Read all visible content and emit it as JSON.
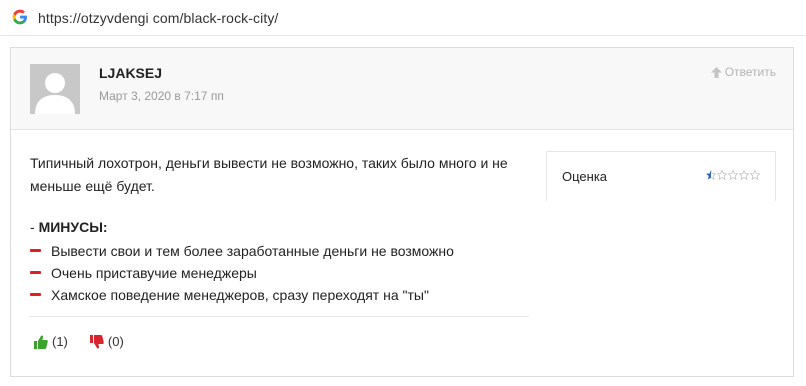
{
  "browser": {
    "url": "https://otzyvdengi com/black-rock-city/"
  },
  "review": {
    "author": "LJAKSEJ",
    "date": "Март 3, 2020 в 7:17 пп",
    "reply_label": "Ответить",
    "text": "Типичный лохотрон, деньги вывести не возможно, таких было много и не меньше ещё будет.",
    "cons_prefix": "- ",
    "cons_title": "МИНУСЫ:",
    "cons": [
      "Вывести свои и тем более заработанные деньги не возможно",
      "Очень приставучие менеджеры",
      "Хамское поведение менеджеров, сразу переходят на \"ты\""
    ],
    "likes": "(1)",
    "dislikes": "(0)",
    "rating_label": "Оценка",
    "rating_value": 0.5,
    "rating_max": 5
  },
  "colors": {
    "dash": "#e02020",
    "thumb_up": "#3ba22d",
    "thumb_down": "#d9232e",
    "star": "#2a63b8"
  },
  "icons": {
    "browser": "google-g-icon",
    "reply": "arrow-up-icon",
    "like": "thumbs-up-icon",
    "dislike": "thumbs-down-icon",
    "rating": "star-icon"
  }
}
